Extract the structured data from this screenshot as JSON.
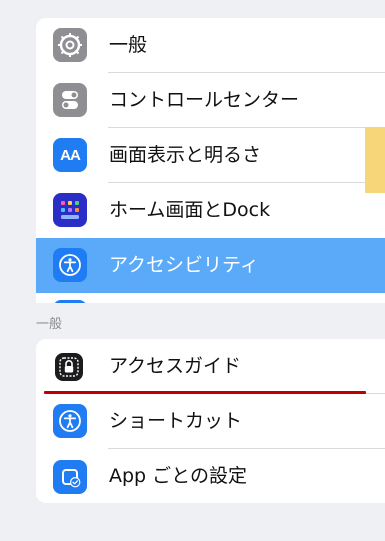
{
  "settings_list": {
    "items": [
      {
        "label": "一般",
        "icon": "gear-icon"
      },
      {
        "label": "コントロールセンター",
        "icon": "toggle-icon"
      },
      {
        "label": "画面表示と明るさ",
        "icon": "text-size-icon"
      },
      {
        "label": "ホーム画面とDock",
        "icon": "app-grid-icon"
      },
      {
        "label": "アクセシビリティ",
        "icon": "accessibility-icon",
        "selected": true
      }
    ],
    "selected_color": "#5aaaf9"
  },
  "section": {
    "header": "一般",
    "items": [
      {
        "label": "アクセスガイド",
        "icon": "lock-icon"
      },
      {
        "label": "ショートカット",
        "icon": "accessibility-icon"
      },
      {
        "label": "App ごとの設定",
        "icon": "app-settings-icon"
      }
    ]
  },
  "icons": {
    "text_size_icon_text": "AA"
  },
  "colors": {
    "background": "#eff0f4",
    "accent": "#1f7cf2",
    "highlight_tab": "#f7d679",
    "annotation_line": "#c00000"
  }
}
